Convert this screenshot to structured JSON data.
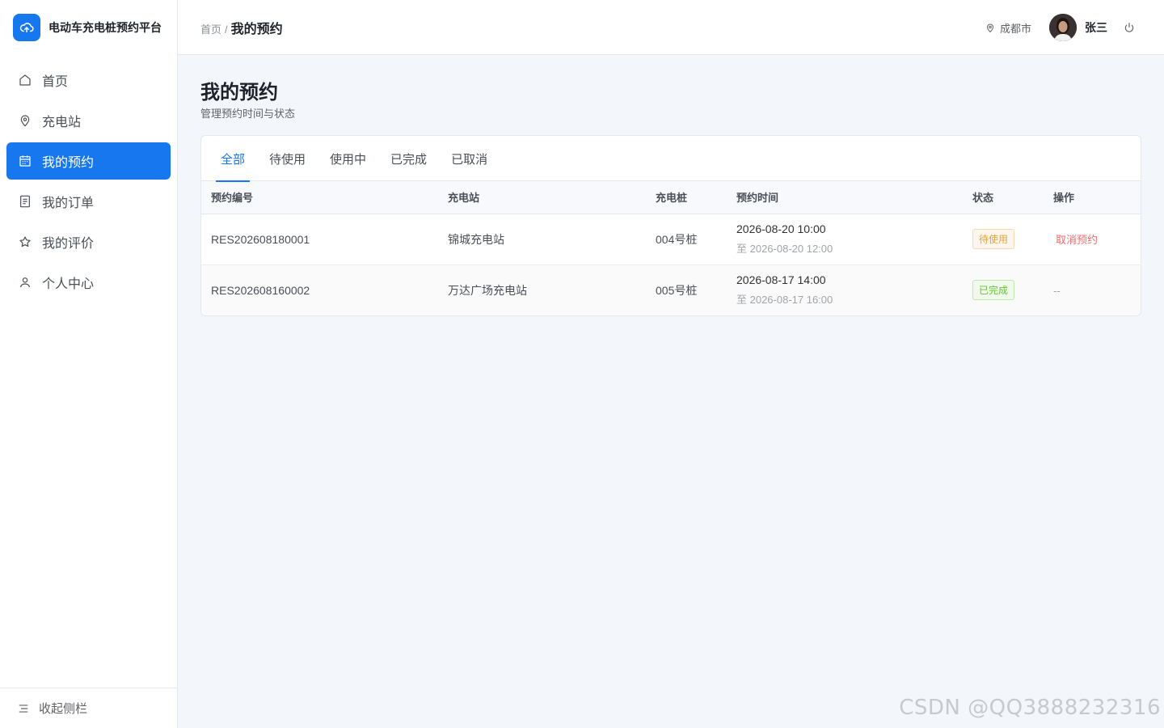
{
  "brand": {
    "title": "电动车充电桩预约平台",
    "icon": "cloud-upload-icon"
  },
  "sidebar": {
    "items": [
      {
        "label": "首页",
        "icon": "home-icon",
        "active": false
      },
      {
        "label": "充电站",
        "icon": "location-pin-icon",
        "active": false
      },
      {
        "label": "我的预约",
        "icon": "calendar-icon",
        "active": true
      },
      {
        "label": "我的订单",
        "icon": "document-icon",
        "active": false
      },
      {
        "label": "我的评价",
        "icon": "star-icon",
        "active": false
      },
      {
        "label": "个人中心",
        "icon": "user-icon",
        "active": false
      }
    ],
    "collapse_label": "收起侧栏"
  },
  "header": {
    "breadcrumb_home": "首页",
    "breadcrumb_sep": "/",
    "breadcrumb_current": "我的预约",
    "city": "成都市",
    "username": "张三"
  },
  "page": {
    "title": "我的预约",
    "subtitle": "管理预约时间与状态"
  },
  "tabs": [
    {
      "label": "全部",
      "active": true
    },
    {
      "label": "待使用",
      "active": false
    },
    {
      "label": "使用中",
      "active": false
    },
    {
      "label": "已完成",
      "active": false
    },
    {
      "label": "已取消",
      "active": false
    }
  ],
  "table": {
    "columns": [
      "预约编号",
      "充电站",
      "充电桩",
      "预约时间",
      "状态",
      "操作"
    ],
    "rows": [
      {
        "id": "RES202608180001",
        "station": "锦城充电站",
        "pile": "004号桩",
        "time_start": "2026-08-20 10:00",
        "time_end": "至 2026-08-20 12:00",
        "status": "待使用",
        "status_type": "pending",
        "action": "取消预约"
      },
      {
        "id": "RES202608160002",
        "station": "万达广场充电站",
        "pile": "005号桩",
        "time_start": "2026-08-17 14:00",
        "time_end": "至 2026-08-17 16:00",
        "status": "已完成",
        "status_type": "done",
        "action": "--"
      }
    ]
  },
  "watermark": "CSDN @QQ3888232316",
  "colors": {
    "primary": "#1677ef",
    "danger": "#f56c6c",
    "warning": "#e6a23c",
    "success": "#67c23a"
  }
}
